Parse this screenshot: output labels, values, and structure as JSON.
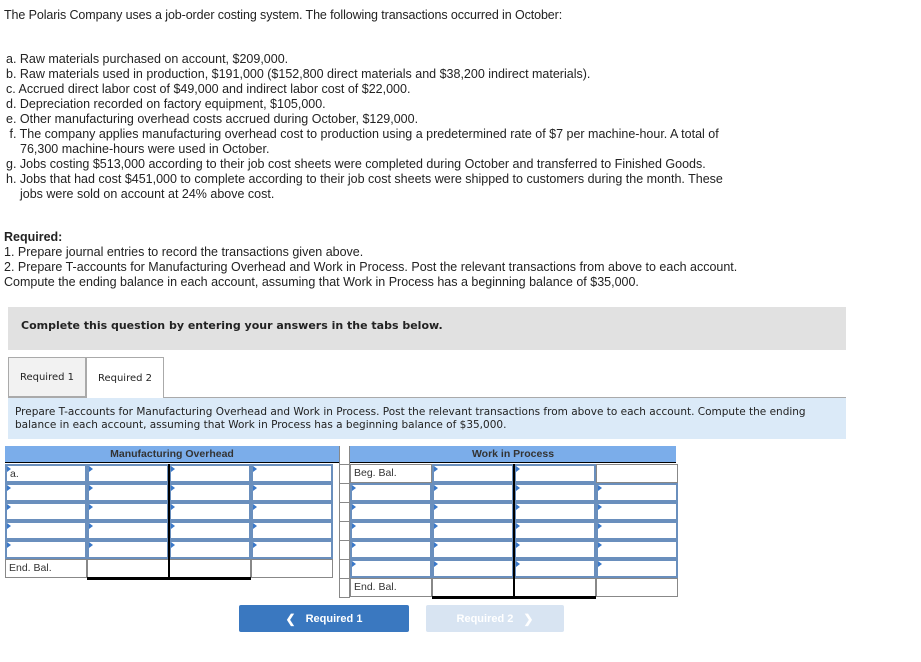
{
  "intro": "The Polaris Company uses a job-order costing system. The following transactions occurred in October:",
  "transactions": [
    {
      "text": "a. Raw materials purchased on account, $209,000."
    },
    {
      "text": "b. Raw materials used in production, $191,000 ($152,800 direct materials and $38,200 indirect materials)."
    },
    {
      "text": "c. Accrued direct labor cost of $49,000 and indirect labor cost of $22,000."
    },
    {
      "text": "d. Depreciation recorded on factory equipment, $105,000."
    },
    {
      "text": "e. Other manufacturing overhead costs accrued during October, $129,000."
    },
    {
      "text": " f. The company applies manufacturing overhead cost to production using a predetermined rate of $7 per machine-hour. A total of",
      "cont": "76,300 machine-hours were used in October."
    },
    {
      "text": "g. Jobs costing $513,000 according to their job cost sheets were completed during October and transferred to Finished Goods."
    },
    {
      "text": "h. Jobs that had cost $451,000 to complete according to their job cost sheets were shipped to customers during the month. These",
      "cont": "jobs were sold on account at 24% above cost."
    }
  ],
  "required": {
    "title": "Required:",
    "items": [
      "1. Prepare journal entries to record the transactions given above.",
      "2. Prepare T-accounts for Manufacturing Overhead and Work in Process. Post the relevant transactions from above to each account.",
      "Compute the ending balance in each account, assuming that Work in Process has a beginning balance of $35,000."
    ]
  },
  "instruction_bar": "Complete this question by entering your answers in the tabs below.",
  "tabs": [
    {
      "label": "Required 1",
      "active": false
    },
    {
      "label": "Required 2",
      "active": true
    }
  ],
  "prompt": "Prepare T-accounts for Manufacturing Overhead and Work in Process. Post the relevant transactions from above to each account. Compute the ending balance in each account, assuming that Work in Process has a beginning balance of $35,000.",
  "t_accounts": {
    "manufacturing_overhead": {
      "title": "Manufacturing Overhead",
      "first_row_label": "a.",
      "end_label": "End. Bal."
    },
    "work_in_process": {
      "title": "Work in Process",
      "beg_label": "Beg. Bal.",
      "end_label": "End. Bal."
    }
  },
  "nav": {
    "prev_label": "Required 1",
    "next_label": "Required 2",
    "prev_icon": "chevron-left-icon",
    "next_icon": "chevron-right-icon"
  },
  "colors": {
    "header_blue": "#7badea",
    "button_blue": "#3a78c0",
    "button_disabled": "#d8e4f2",
    "prompt_bg": "#dbeaf8",
    "instruction_bg": "#e1e1e1"
  }
}
